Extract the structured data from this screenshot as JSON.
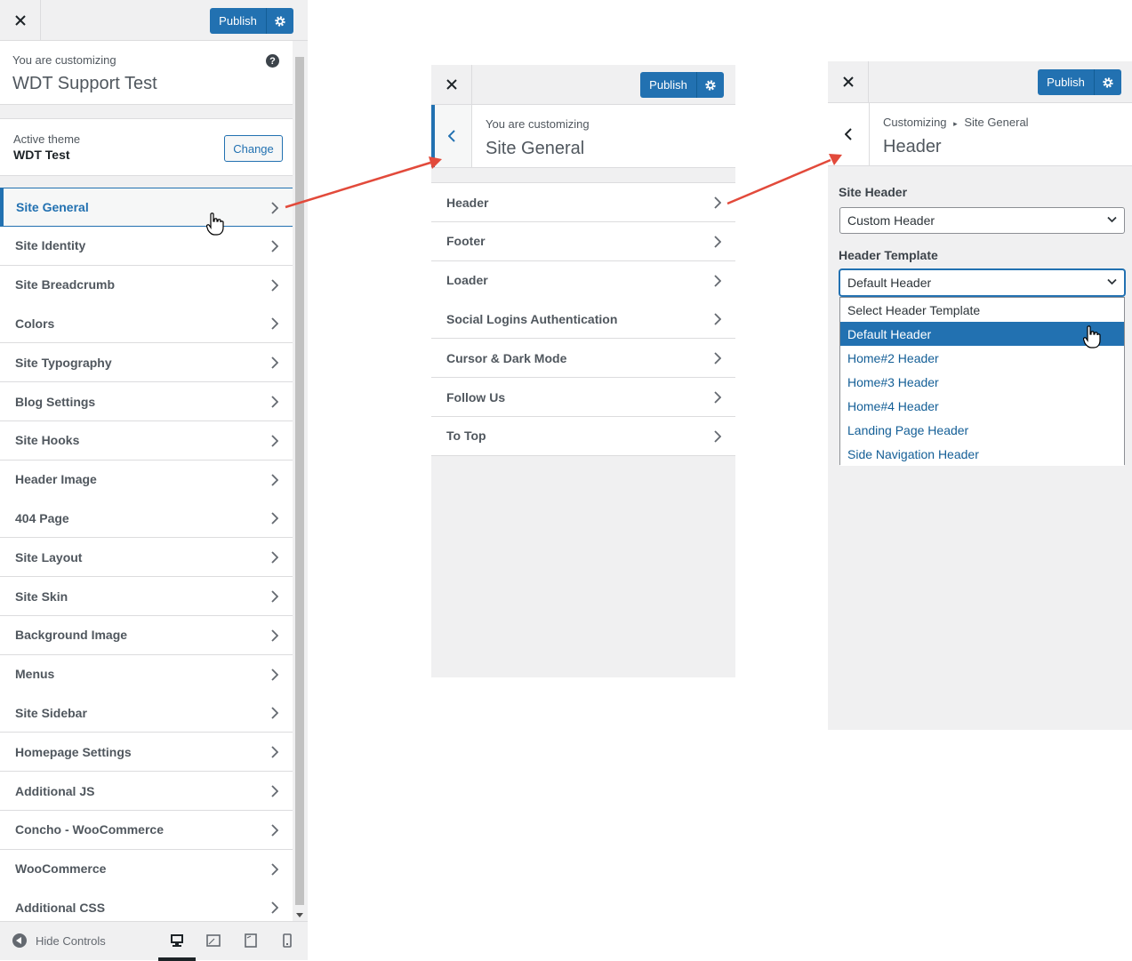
{
  "colors": {
    "accent": "#2271b1",
    "annotation_arrow": "#e24a3b",
    "selected_option_bg": "#2271b1"
  },
  "panel1": {
    "close_icon": "close-icon",
    "publish_label": "Publish",
    "gear_icon": "gear-icon",
    "customizing_label": "You are customizing",
    "site_title": "WDT Support Test",
    "help_icon": "help-icon",
    "active_theme_label": "Active theme",
    "theme_name": "WDT Test",
    "change_label": "Change",
    "items": [
      "Site General",
      "Site Identity",
      "Site Breadcrumb",
      "Colors",
      "Site Typography",
      "Blog Settings",
      "Site Hooks",
      "Header Image",
      "404 Page",
      "Site Layout",
      "Site Skin",
      "Background Image",
      "Menus",
      "Site Sidebar",
      "Homepage Settings",
      "Additional JS",
      "Concho - WooCommerce",
      "WooCommerce",
      "Additional CSS"
    ],
    "hide_controls_label": "Hide Controls",
    "devices": [
      "desktop-icon",
      "tablet-icon",
      "tablet-portrait-icon",
      "mobile-icon"
    ]
  },
  "panel2": {
    "publish_label": "Publish",
    "customizing_label": "You are customizing",
    "section_title": "Site General",
    "items": [
      "Header",
      "Footer",
      "Loader",
      "Social Logins Authentication",
      "Cursor & Dark Mode",
      "Follow Us",
      "To Top"
    ]
  },
  "panel3": {
    "publish_label": "Publish",
    "breadcrumb_root": "Customizing",
    "breadcrumb_sep": "▸",
    "breadcrumb_parent": "Site General",
    "section_title": "Header",
    "site_header_label": "Site Header",
    "site_header_value": "Custom Header",
    "header_template_label": "Header Template",
    "header_template_value": "Default Header",
    "options": [
      "Select Header Template",
      "Default Header",
      "Home#2 Header",
      "Home#3 Header",
      "Home#4 Header",
      "Landing Page Header",
      "Side Navigation Header"
    ],
    "selected_option_index": 1
  }
}
